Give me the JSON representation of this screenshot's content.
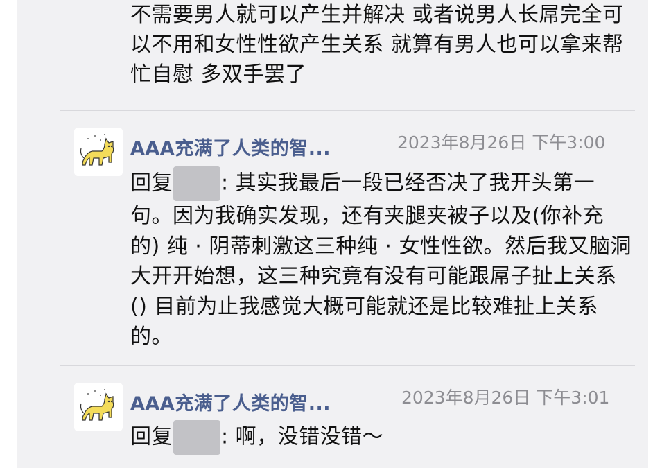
{
  "top_text": "不需要男人就可以产生并解决 或者说男人长屌完全可以不用和女性性欲产生关系 就算有男人也可以拿来帮忙自慰 多双手罢了",
  "comments": [
    {
      "username": "AAA充满了人类的智...",
      "timestamp": "2023年8月26日 下午3:00",
      "reply_prefix": "回复",
      "text": ": 其实我最后一段已经否决了我开头第一句。因为我确实发现，还有夹腿夹被子以及(你补充的) 纯 · 阴蒂刺激这三种纯 · 女性性欲。然后我又脑洞大开开始想，这三种究竟有没有可能跟屌子扯上关系 () 目前为止我感觉大概可能就还是比较难扯上关系的。"
    },
    {
      "username": "AAA充满了人类的智...",
      "timestamp": "2023年8月26日 下午3:01",
      "reply_prefix": "回复",
      "text": ": 啊，没错没错～"
    }
  ],
  "colors": {
    "background": "#f1f1f3",
    "username": "#4a5e8e",
    "timestamp": "#8d8d92",
    "redaction": "#c2c2c6"
  },
  "icons": {
    "avatar": "yellow-cat-avatar-icon"
  }
}
